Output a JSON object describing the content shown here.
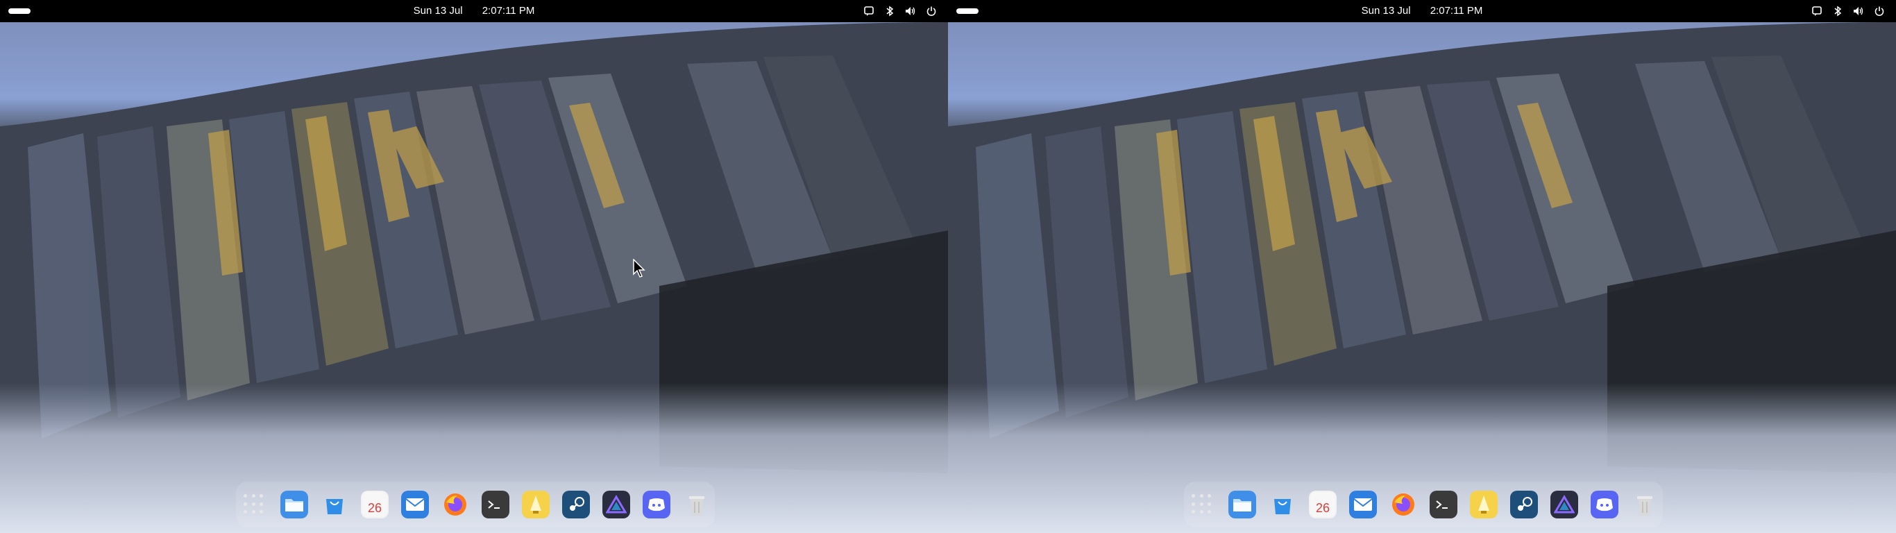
{
  "screens": [
    {
      "topbar": {
        "activities": "activities-indicator",
        "date": "Sun 13 Jul",
        "time": "2:07:11 PM",
        "tray": [
          "chat-icon",
          "bluetooth-icon",
          "volume-icon",
          "power-icon"
        ]
      },
      "dock": {
        "apps": [
          {
            "name": "Show Applications",
            "icon": "app-grid-icon"
          },
          {
            "name": "Files",
            "icon": "folder-icon"
          },
          {
            "name": "Software",
            "icon": "shopping-bag-icon"
          },
          {
            "name": "Calendar",
            "icon": "calendar-icon",
            "day": "26"
          },
          {
            "name": "Mail",
            "icon": "mail-icon"
          },
          {
            "name": "Firefox",
            "icon": "firefox-icon"
          },
          {
            "name": "Terminal",
            "icon": "terminal-icon"
          },
          {
            "name": "Notes",
            "icon": "notes-icon"
          },
          {
            "name": "Steam",
            "icon": "steam-icon"
          },
          {
            "name": "Affinity",
            "icon": "affinity-icon"
          },
          {
            "name": "Discord",
            "icon": "discord-icon"
          },
          {
            "name": "Trash",
            "icon": "trash-icon"
          }
        ]
      }
    },
    {
      "topbar": {
        "activities": "activities-indicator",
        "date": "Sun 13 Jul",
        "time": "2:07:11 PM",
        "tray": [
          "chat-icon",
          "bluetooth-icon",
          "volume-icon",
          "power-icon"
        ]
      },
      "dock": {
        "apps": [
          {
            "name": "Show Applications",
            "icon": "app-grid-icon"
          },
          {
            "name": "Files",
            "icon": "folder-icon"
          },
          {
            "name": "Software",
            "icon": "shopping-bag-icon"
          },
          {
            "name": "Calendar",
            "icon": "calendar-icon",
            "day": "26"
          },
          {
            "name": "Mail",
            "icon": "mail-icon"
          },
          {
            "name": "Firefox",
            "icon": "firefox-icon"
          },
          {
            "name": "Terminal",
            "icon": "terminal-icon"
          },
          {
            "name": "Notes",
            "icon": "notes-icon"
          },
          {
            "name": "Steam",
            "icon": "steam-icon"
          },
          {
            "name": "Affinity",
            "icon": "affinity-icon"
          },
          {
            "name": "Discord",
            "icon": "discord-icon"
          },
          {
            "name": "Trash",
            "icon": "trash-icon"
          }
        ]
      }
    }
  ],
  "colors": {
    "topbar": "#000000",
    "sky": "#8fa5d6",
    "rock_dark": "#2b2f36",
    "rock_mid": "#59606c",
    "lichen": "#c9a54a",
    "surf": "#c9d2e4"
  }
}
